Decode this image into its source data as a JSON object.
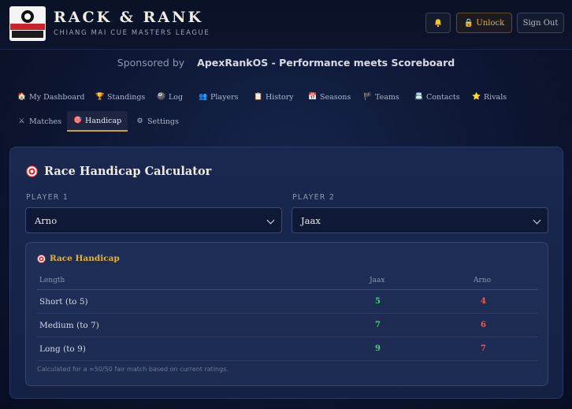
{
  "header": {
    "logo_text": "CHIANG MAI CUE MASTERS",
    "title": "RACK & RANK",
    "subtitle": "CHIANG MAI CUE MASTERS LEAGUE",
    "unlock_label": "🔒 Unlock",
    "signout_label": "Sign Out",
    "bell_icon": "bell-icon"
  },
  "sponsor": {
    "prefix": "Sponsored by",
    "name": "ApexRankOS - Performance meets Scoreboard"
  },
  "nav": {
    "row1": [
      {
        "icon": "🏠",
        "label": "My Dashboard"
      },
      {
        "icon": "🏆",
        "label": "Standings"
      },
      {
        "icon": "🎱",
        "label": "Log"
      },
      {
        "icon": "👥",
        "label": "Players"
      },
      {
        "icon": "📋",
        "label": "History"
      },
      {
        "icon": "📅",
        "label": "Seasons"
      },
      {
        "icon": "🏴",
        "label": "Teams"
      },
      {
        "icon": "📇",
        "label": "Contacts"
      },
      {
        "icon": "⭐",
        "label": "Rivals"
      }
    ],
    "row2": [
      {
        "icon": "⚔",
        "label": "Matches"
      },
      {
        "icon": "🎯",
        "label": "Handicap",
        "active": true
      },
      {
        "icon": "⚙",
        "label": "Settings"
      }
    ]
  },
  "calculator": {
    "title": "Race Handicap Calculator",
    "player1_label": "PLAYER 1",
    "player2_label": "PLAYER 2",
    "player1_value": "Arno",
    "player2_value": "Jaax",
    "panel_title": "Race Handicap",
    "columns": [
      "Length",
      "Jaax",
      "Arno"
    ],
    "rows": [
      {
        "length": "Short (to 5)",
        "jaax": "5",
        "arno": "4"
      },
      {
        "length": "Medium (to 7)",
        "jaax": "7",
        "arno": "6"
      },
      {
        "length": "Long (to 9)",
        "jaax": "9",
        "arno": "7"
      }
    ],
    "note": "Calculated for a ≈50/50 fair match based on current ratings."
  },
  "colors": {
    "accent_gold": "#e1b43a",
    "positive_green": "#4ccf7c",
    "negative_red": "#ef5a5a"
  }
}
